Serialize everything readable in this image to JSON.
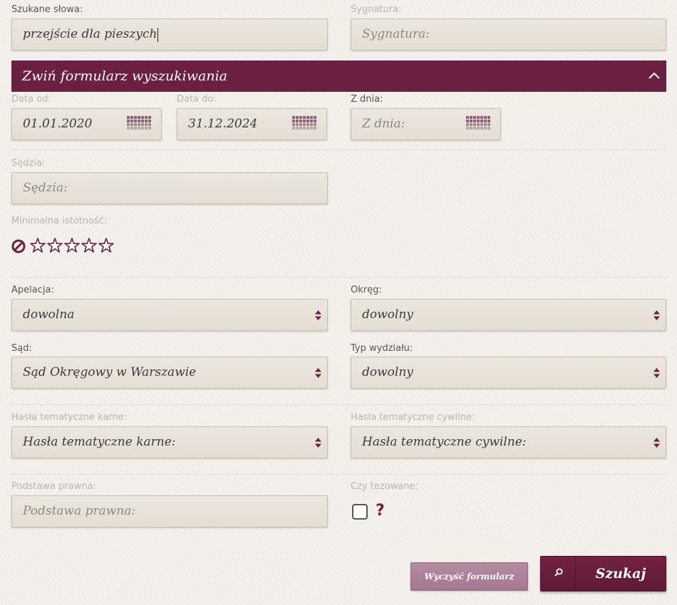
{
  "search": {
    "keywords_label": "Szukane słowa:",
    "keywords_value": "przejście dla pieszych",
    "signature_label": "Sygnatura:",
    "signature_placeholder": "Sygnatura:"
  },
  "collapse_bar": {
    "label": "Zwiń formularz wyszukiwania",
    "icon": "chevron-up-icon",
    "color": "#6b1f41"
  },
  "dates": {
    "from_label": "Data od:",
    "from_value": "01.01.2020",
    "to_label": "Data do:",
    "to_value": "31.12.2024",
    "day_label": "Z dnia:",
    "day_placeholder": "Z dnia:",
    "icon": "calendar-icon"
  },
  "judge": {
    "label": "Sędzia:",
    "placeholder": "Sędzia:"
  },
  "relevance": {
    "label": "Minimalna istotność:",
    "clear_icon": "no-entry-icon",
    "star_icon": "star-outline-icon",
    "rating": 0,
    "max": 5
  },
  "appeal": {
    "label": "Apelacja:",
    "value": "dowolna"
  },
  "district": {
    "label": "Okręg:",
    "value": "dowolny"
  },
  "court": {
    "label": "Sąd:",
    "value": "Sąd Okręgowy w Warszawie"
  },
  "division_type": {
    "label": "Typ wydziału:",
    "value": "dowolny"
  },
  "criminal_topics": {
    "label": "Hasła tematyczne karne:",
    "value": "Hasła tematyczne karne:"
  },
  "civil_topics": {
    "label": "Hasła tematyczne cywilne:",
    "value": "Hasła tematyczne cywilne:"
  },
  "legal_basis": {
    "label": "Podstawa prawna:",
    "placeholder": "Podstawa prawna:"
  },
  "theses": {
    "label": "Czy tezowane:",
    "checked": false,
    "help_text": "?"
  },
  "buttons": {
    "clear_label": "Wyczyść formularz",
    "search_label": "Szukaj",
    "search_icon": "search-icon"
  },
  "colors": {
    "accent": "#6b1f41",
    "clear_button": "#a4788f",
    "field_bg": "#e7e1d8",
    "page_bg": "#f4f1ec"
  }
}
